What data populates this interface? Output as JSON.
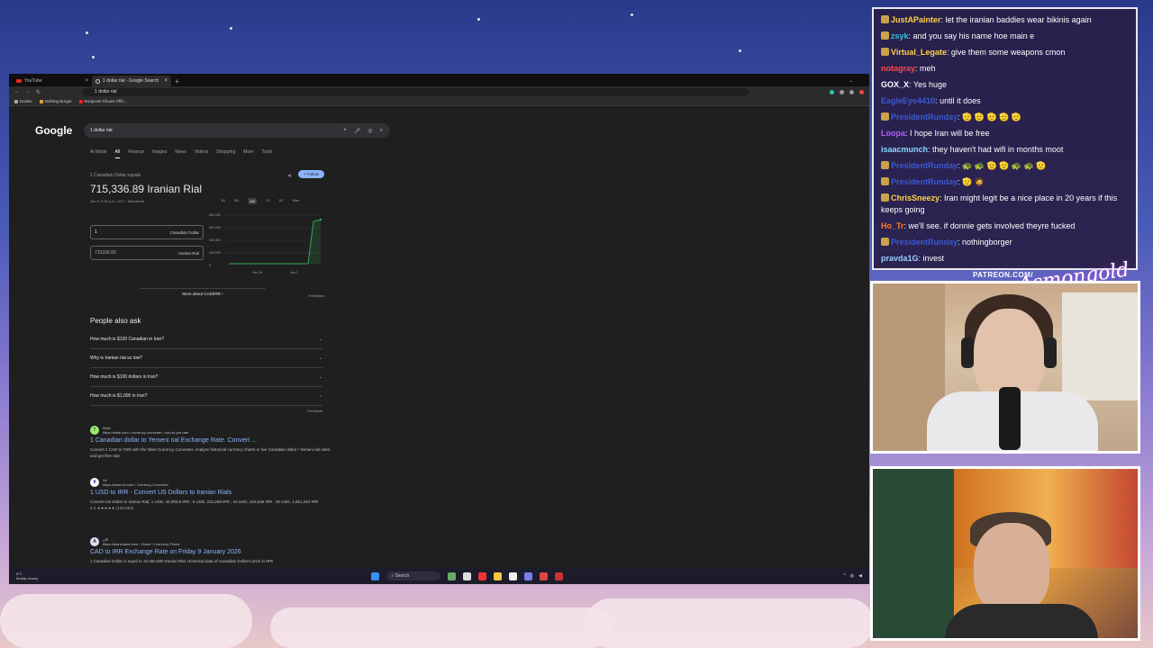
{
  "browser": {
    "tabs": [
      {
        "label": "YouTube"
      },
      {
        "label": "1 dollar rial - Google Search"
      }
    ],
    "new_tab": "+",
    "address": "1 dollar rial",
    "bookmarks": [
      "Dailies",
      "Nothing Burger",
      "Bodycam Shows Offic..."
    ]
  },
  "google": {
    "logo": "Google",
    "query": "1 dollar rial",
    "nav": [
      "AI Mode",
      "All",
      "Finance",
      "Images",
      "News",
      "Videos",
      "Shopping",
      "More",
      "Tools"
    ],
    "converter": {
      "label": "1 Canadian Dollar equals",
      "amount": "715,336.89 Iranian Rial",
      "date": "Jan 9, 5:54 p.m. UTC · Disclaimer",
      "follow": "+ Follow",
      "from_value": "1",
      "from_currency": "Canadian Dollar",
      "to_value": "715336.89",
      "to_currency": "Iranian Rial",
      "ranges": [
        "1D",
        "5D",
        "1M",
        "1Y",
        "5Y",
        "Max"
      ],
      "selected_range": "1M",
      "y_ticks": [
        "800,000",
        "600,000",
        "400,000",
        "200,000",
        "0"
      ],
      "x_ticks": [
        "Dec 16",
        "Jan 2"
      ],
      "more_about": "More about CAD/IRR",
      "feedback": "Feedback"
    },
    "paa": {
      "title": "People also ask",
      "questions": [
        "How much is $100 Canadian in Iran?",
        "Why is Iranian rial so low?",
        "How much is $100 dollars in Iran?",
        "How much is $1,000 in Iran?"
      ],
      "feedback": "Feedback"
    },
    "results": [
      {
        "favicon": "7",
        "site": "Wise",
        "url": "https://wise.com › currency-converter › cad-to-yer-rate",
        "title": "1 Canadian dollar to Yemeni rial Exchange Rate. Convert ...",
        "snippet": "Convert 1 CAD to YER with the Wise Currency Converter. Analyze historical currency charts or live Canadian dollar / Yemeni rial rates and get free rate"
      },
      {
        "favicon": "X",
        "site": "Xe",
        "url": "https://www.xe.com › Currency Converter",
        "title": "1 USD to IRR - Convert US Dollars to Iranian Rials",
        "snippet": "Convert US Dollar to Iranian Rial; 1 USD, 42,093.6 IRR ; 5 USD, 210,268 IRR ; 10 USD, 420,536 IRR ; 25 USD, 1,051,340 IRR",
        "rating": "4.3 ★★★★★ (105,053)"
      },
      {
        "favicon": "A",
        "site": "الان",
        "url": "https://alanchand.com › Home › Currency Prices",
        "title": "CAD to IRR Exchange Rate on Friday 9 January 2026",
        "snippet": "1 Canadian Dollar is equal to 10,450,000 Iranian Rial. Historical data of Canadian Dollar's price in IRR"
      }
    ]
  },
  "taskbar": {
    "weather_temp": "8°C",
    "weather_desc": "Mostly cloudy",
    "search": "Search"
  },
  "chat": [
    {
      "user": "JustAPainter",
      "color": "#ffd24a",
      "text": "let the iranian baddies wear bikinis again",
      "badge": true
    },
    {
      "user": "zsyk",
      "color": "#2ec4d6",
      "text": "and you say his name hoe main e",
      "badge": true
    },
    {
      "user": "Virtual_Legate",
      "color": "#ffd24a",
      "text": "give them some weapons cmon",
      "badge": true
    },
    {
      "user": "notagray",
      "color": "#ff4a4a",
      "text": "meh",
      "badge": false
    },
    {
      "user": "GOX_X",
      "color": "#ffffff",
      "text": "Yes huge",
      "badge": false
    },
    {
      "user": "EagleEye4410",
      "color": "#3a5ad0",
      "text": "until it does",
      "badge": false
    },
    {
      "user": "PresidentRunday",
      "color": "#3a5ad0",
      "text": "🫡 🫡 🫡 🫡 🫡",
      "badge": true
    },
    {
      "user": "Loopa",
      "color": "#b060ff",
      "text": "I hope Iran will be free",
      "badge": false
    },
    {
      "user": "isaacmunch",
      "color": "#8ad8ff",
      "text": "they haven't had wifi in months moot",
      "badge": false
    },
    {
      "user": "PresidentRunday",
      "color": "#3a5ad0",
      "text": "🐢 🐢 🫡 🫡 🐢 🐢 🫡",
      "badge": true
    },
    {
      "user": "PresidentRunday",
      "color": "#3a5ad0",
      "text": "🫡 🧔",
      "badge": true
    },
    {
      "user": "ChrisSneezy",
      "color": "#ffd24a",
      "text": "Iran might legit be a nice place in 20 years if this keeps going",
      "badge": true
    },
    {
      "user": "Ho_Tr",
      "color": "#ff7a2a",
      "text": "we'll see. if donnie gets involved theyre fucked",
      "badge": false
    },
    {
      "user": "PresidentRunday",
      "color": "#3a5ad0",
      "text": "nothingborger",
      "badge": true
    },
    {
      "user": "pravda1G",
      "color": "#9ad0ff",
      "text": "invest",
      "badge": false
    }
  ],
  "overlay": {
    "patreon": "PATREON.COM/"
  },
  "colors": {
    "link": "#8ab4f8",
    "chart_line": "#34a853"
  }
}
